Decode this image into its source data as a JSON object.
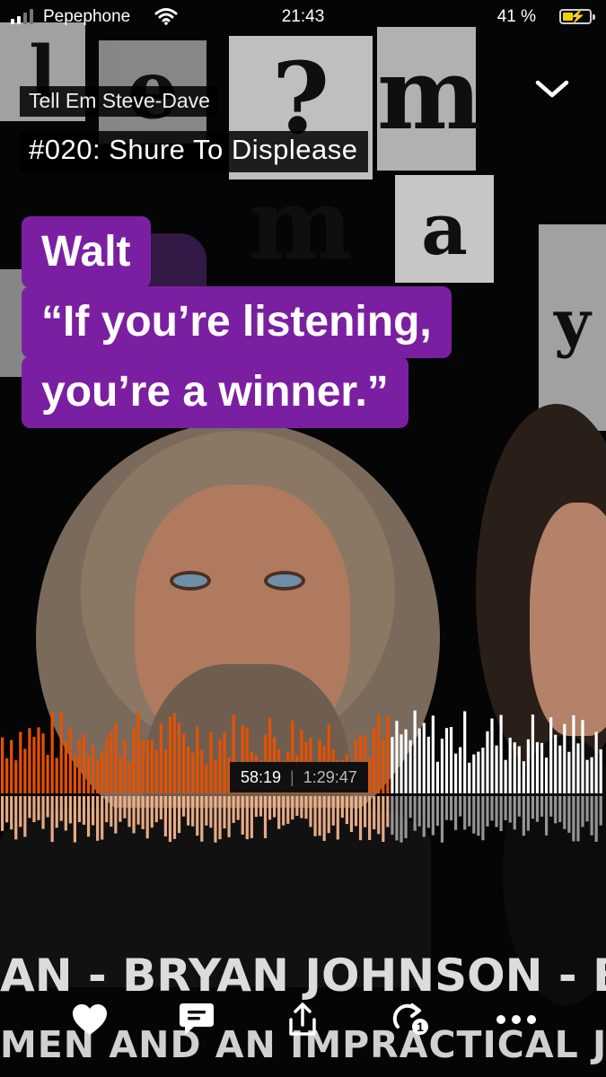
{
  "status_bar": {
    "carrier": "Pepephone",
    "time": "21:43",
    "battery_percent": "41 %",
    "battery_level": 0.41,
    "signal_bars": 2,
    "charging": true
  },
  "player": {
    "podcast_name": "Tell Em Steve-Dave",
    "episode_title": "#020: Shure To Displease",
    "collapse_icon": "chevron-down-icon"
  },
  "quote": {
    "speaker": "Walt",
    "lines": [
      "“If you’re listening,",
      "you’re a winner.”"
    ],
    "background_color": "#7b1fa2"
  },
  "playback": {
    "elapsed": "58:19",
    "total": "1:29:47",
    "progress": 0.649,
    "played_color": "#e65100",
    "played_reflection_color": "#f3b48c",
    "unplayed_color": "#ffffff"
  },
  "artwork": {
    "banner_line_1": "AN - BRYAN JOHNSON - BRIAN",
    "banner_line_2": "MEN AND AN IMPRACTICAL JOKER. UNC"
  },
  "actions": [
    {
      "name": "like-button",
      "icon": "heart-icon"
    },
    {
      "name": "comment-button",
      "icon": "comment-icon"
    },
    {
      "name": "share-button",
      "icon": "share-icon"
    },
    {
      "name": "repeat-button",
      "icon": "repeat-one-icon",
      "badge": "1"
    },
    {
      "name": "more-button",
      "icon": "more-icon"
    }
  ]
}
